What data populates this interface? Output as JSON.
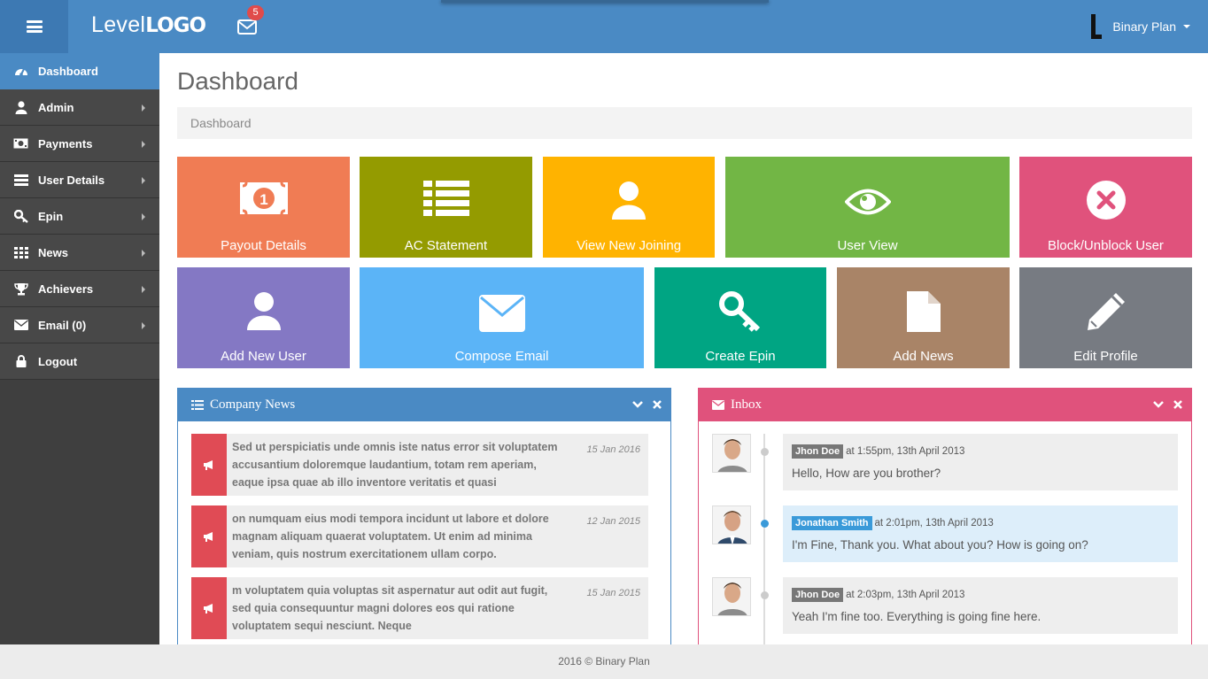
{
  "brand": {
    "logo_light": "Level",
    "logo_bold": "LOGO"
  },
  "header": {
    "mail_badge": "5",
    "user_name": "Binary Plan",
    "color": "#4a8ac4"
  },
  "sidebar": {
    "items": [
      {
        "label": "Dashboard",
        "icon": "dashboard-icon",
        "active": true,
        "has_submenu": false
      },
      {
        "label": "Admin",
        "icon": "user-icon",
        "has_submenu": true
      },
      {
        "label": "Payments",
        "icon": "money-icon",
        "has_submenu": true
      },
      {
        "label": "User Details",
        "icon": "list-icon",
        "has_submenu": true
      },
      {
        "label": "Epin",
        "icon": "key-icon",
        "has_submenu": true
      },
      {
        "label": "News",
        "icon": "grid-icon",
        "has_submenu": true
      },
      {
        "label": "Achievers",
        "icon": "trophy-icon",
        "has_submenu": true
      },
      {
        "label": "Email (0)",
        "icon": "envelope-icon",
        "has_submenu": true
      },
      {
        "label": "Logout",
        "icon": "lock-icon",
        "has_submenu": false
      }
    ]
  },
  "page": {
    "title": "Dashboard",
    "breadcrumb": "Dashboard"
  },
  "tiles": [
    {
      "label": "Payout Details",
      "icon": "money-icon",
      "color": "#f07c54"
    },
    {
      "label": "AC Statement",
      "icon": "list-icon",
      "color": "#949b00"
    },
    {
      "label": "View New Joining",
      "icon": "user-icon",
      "color": "#ffb300"
    },
    {
      "label": "User View",
      "icon": "eye-icon",
      "color": "#72b645"
    },
    {
      "label": "Block/Unblock User",
      "icon": "times-circle-icon",
      "color": "#e0527c"
    },
    {
      "label": "Add New User",
      "icon": "user-icon",
      "color": "#8478c4"
    },
    {
      "label": "Compose Email",
      "icon": "envelope-icon",
      "color": "#5bb4f7"
    },
    {
      "label": "Create Epin",
      "icon": "key-icon",
      "color": "#00a583"
    },
    {
      "label": "Add News",
      "icon": "file-icon",
      "color": "#a98467"
    },
    {
      "label": "Edit Profile",
      "icon": "pencil-icon",
      "color": "#777b82"
    }
  ],
  "company_news": {
    "title": "Company News",
    "color": "#4a8ac4",
    "items": [
      {
        "text": "Sed ut perspiciatis unde omnis iste natus error sit voluptatem accusantium doloremque laudantium, totam rem aperiam, eaque ipsa quae ab illo inventore veritatis et quasi",
        "date": "15 Jan 2016"
      },
      {
        "text": "on numquam eius modi tempora incidunt ut labore et dolore magnam aliquam quaerat voluptatem. Ut enim ad minima veniam, quis nostrum exercitationem ullam corpo.",
        "date": "12 Jan 2015"
      },
      {
        "text": "m voluptatem quia voluptas sit aspernatur aut odit aut fugit, sed quia consequuntur magni dolores eos qui ratione voluptatem sequi nesciunt. Neque",
        "date": "15 Jan 2015"
      }
    ]
  },
  "inbox": {
    "title": "Inbox",
    "color": "#e0527c",
    "messages": [
      {
        "name": "Jhon Doe",
        "meta": "at 1:55pm, 13th April 2013",
        "text": "Hello, How are you brother?",
        "highlight": false
      },
      {
        "name": "Jonathan Smith",
        "meta": "at 2:01pm, 13th April 2013",
        "text": "I'm Fine, Thank you. What about you? How is going on?",
        "highlight": true
      },
      {
        "name": "Jhon Doe",
        "meta": "at 2:03pm, 13th April 2013",
        "text": "Yeah I'm fine too. Everything is going fine here.",
        "highlight": false
      }
    ]
  },
  "footer": {
    "text": "2016 © Binary Plan"
  }
}
